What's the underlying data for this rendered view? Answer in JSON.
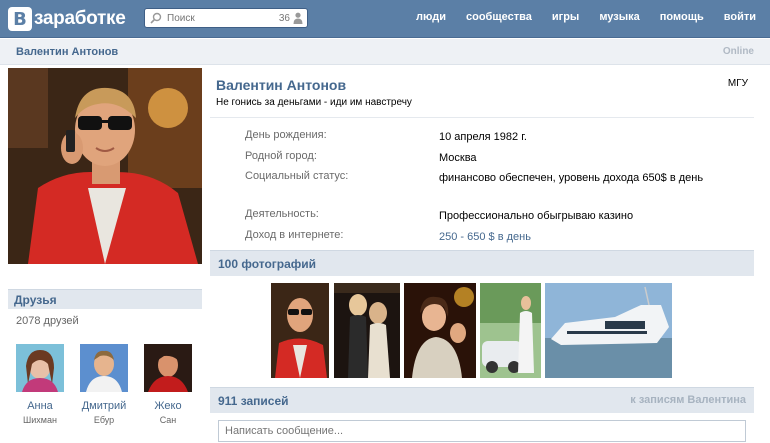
{
  "header": {
    "logo_letter": "В",
    "logo_text": "заработке",
    "search": {
      "placeholder": "Поиск",
      "count": "36"
    },
    "nav": [
      "люди",
      "сообщества",
      "игры",
      "музыка",
      "помощь",
      "войти"
    ]
  },
  "subbar": {
    "name": "Валентин Антонов",
    "online": "Online"
  },
  "profile": {
    "name": "Валентин Антонов",
    "university": "МГУ",
    "status": "Не гонись за деньгами - иди им навстречу",
    "info": [
      {
        "label": "День рождения:",
        "value": "10 апреля 1982 г."
      },
      {
        "label": "Родной город:",
        "value": "Москва"
      },
      {
        "label": "Социальный статус:",
        "value": "финансово обеспечен, уровень дохода 650$ в день"
      },
      {
        "label": "Деятельность:",
        "value": "Профессионально обыгрываю казино"
      },
      {
        "label": "Доход в интернете:",
        "value": "250 - 650 $ в день"
      }
    ]
  },
  "friends": {
    "title": "Друзья",
    "count": "2078 друзей",
    "items": [
      {
        "first": "Анна",
        "last": "Шихман"
      },
      {
        "first": "Дмитрий",
        "last": "Ебур"
      },
      {
        "first": "Жеко",
        "last": "Сан"
      }
    ]
  },
  "photos": {
    "title": "100 фотографий"
  },
  "posts": {
    "count": "911 записей",
    "link": "к записям Валентина",
    "compose_placeholder": "Написать сообщение..."
  },
  "colors": {
    "header": "#5b7fa6",
    "link": "#45688e",
    "section": "#e1e7ee"
  }
}
